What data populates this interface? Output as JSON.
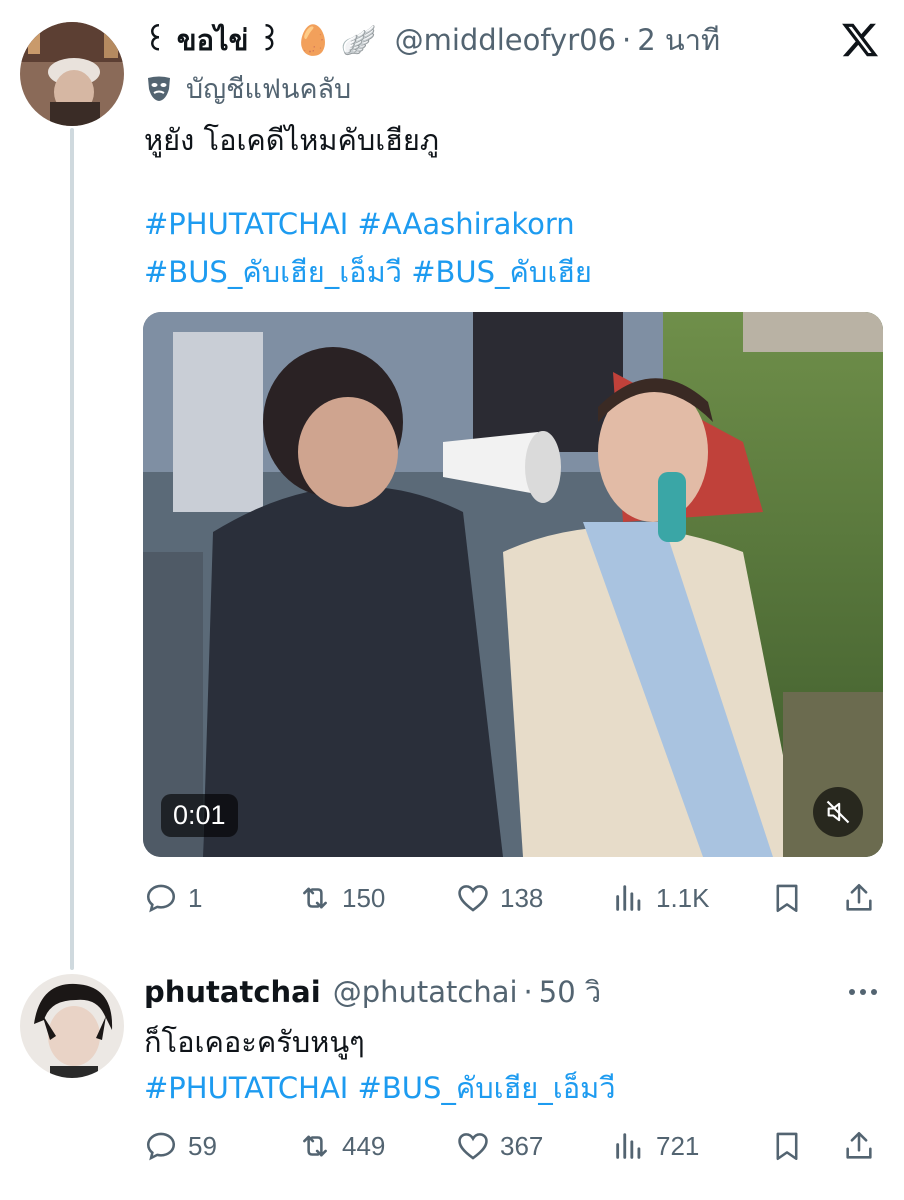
{
  "tweet1": {
    "display_name": "꒰ ขอไข่ ꒱",
    "emojis": "🥚 🪽",
    "handle": "@middleofyr06",
    "separator": "·",
    "time": "2 นาที",
    "badge_text": "บัญชีแฟนคลับ",
    "badge_icon": "theater-mask-icon",
    "text": "หูยัง โอเคดีไหมคับเฮียภู",
    "hashtags_line1": "#PHUTATCHAI #AAashirakorn",
    "hashtags_line2": "#BUS_คับเฮีย_เอ็มวี #BUS_คับเฮีย",
    "video": {
      "duration": "0:01",
      "muted_icon": "speaker-muted-icon"
    },
    "stats": {
      "replies": "1",
      "reposts": "150",
      "likes": "138",
      "views": "1.1K"
    }
  },
  "tweet2": {
    "display_name": "phutatchai",
    "handle": "@phutatchai",
    "separator": "·",
    "time": "50 วิ",
    "text": "ก็โอเคอะครับหนูๆ",
    "hashtags": "#PHUTATCHAI #BUS_คับเฮีย_เอ็มวี",
    "stats": {
      "replies": "59",
      "reposts": "449",
      "likes": "367",
      "views": "721"
    }
  },
  "colors": {
    "text": "#0f1419",
    "secondary": "#536471",
    "link": "#1d9bf0",
    "thread_line": "#cfd9de"
  }
}
